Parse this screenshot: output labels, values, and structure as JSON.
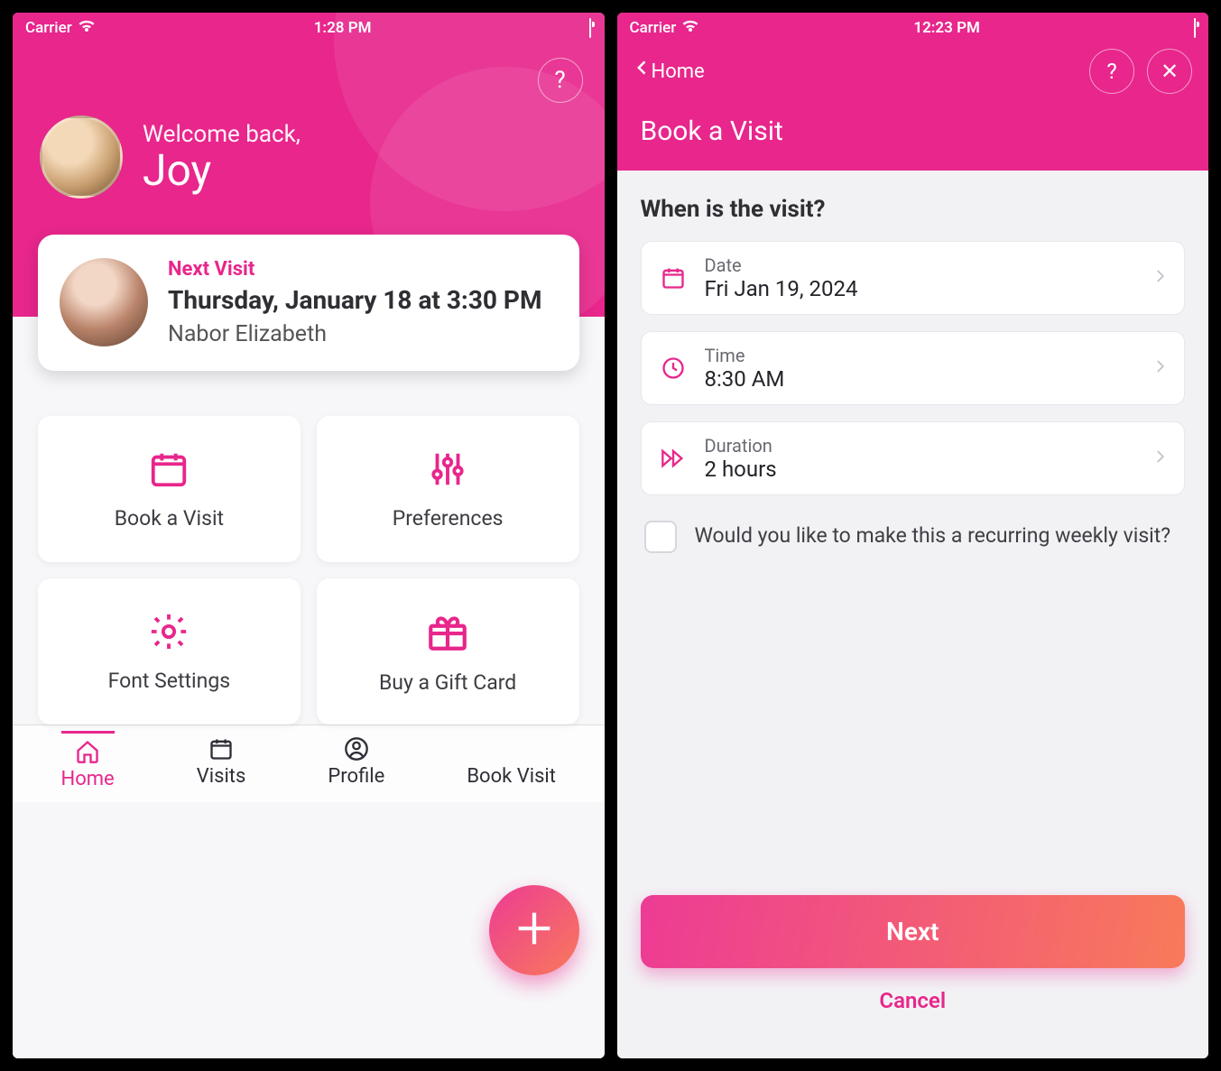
{
  "left": {
    "status": {
      "carrier": "Carrier",
      "time": "1:28 PM"
    },
    "help_glyph": "?",
    "welcome_label": "Welcome back,",
    "user_name": "Joy",
    "next_visit": {
      "label": "Next Visit",
      "title": "Thursday, January 18 at 3:30 PM",
      "who": "Nabor Elizabeth"
    },
    "tiles": {
      "book": "Book a Visit",
      "prefs": "Preferences",
      "font": "Font Settings",
      "gift": "Buy a Gift Card"
    },
    "tabs": {
      "home": "Home",
      "visits": "Visits",
      "profile": "Profile",
      "book": "Book Visit"
    }
  },
  "right": {
    "status": {
      "carrier": "Carrier",
      "time": "12:23 PM"
    },
    "back_label": "Home",
    "help_glyph": "?",
    "close_glyph": "✕",
    "page_title": "Book a Visit",
    "section_heading": "When is the visit?",
    "date": {
      "label": "Date",
      "value": "Fri Jan 19, 2024"
    },
    "time": {
      "label": "Time",
      "value": "8:30 AM"
    },
    "duration": {
      "label": "Duration",
      "value": "2 hours"
    },
    "recurring_text": "Would you like to make this a recurring weekly visit?",
    "next_label": "Next",
    "cancel_label": "Cancel"
  }
}
